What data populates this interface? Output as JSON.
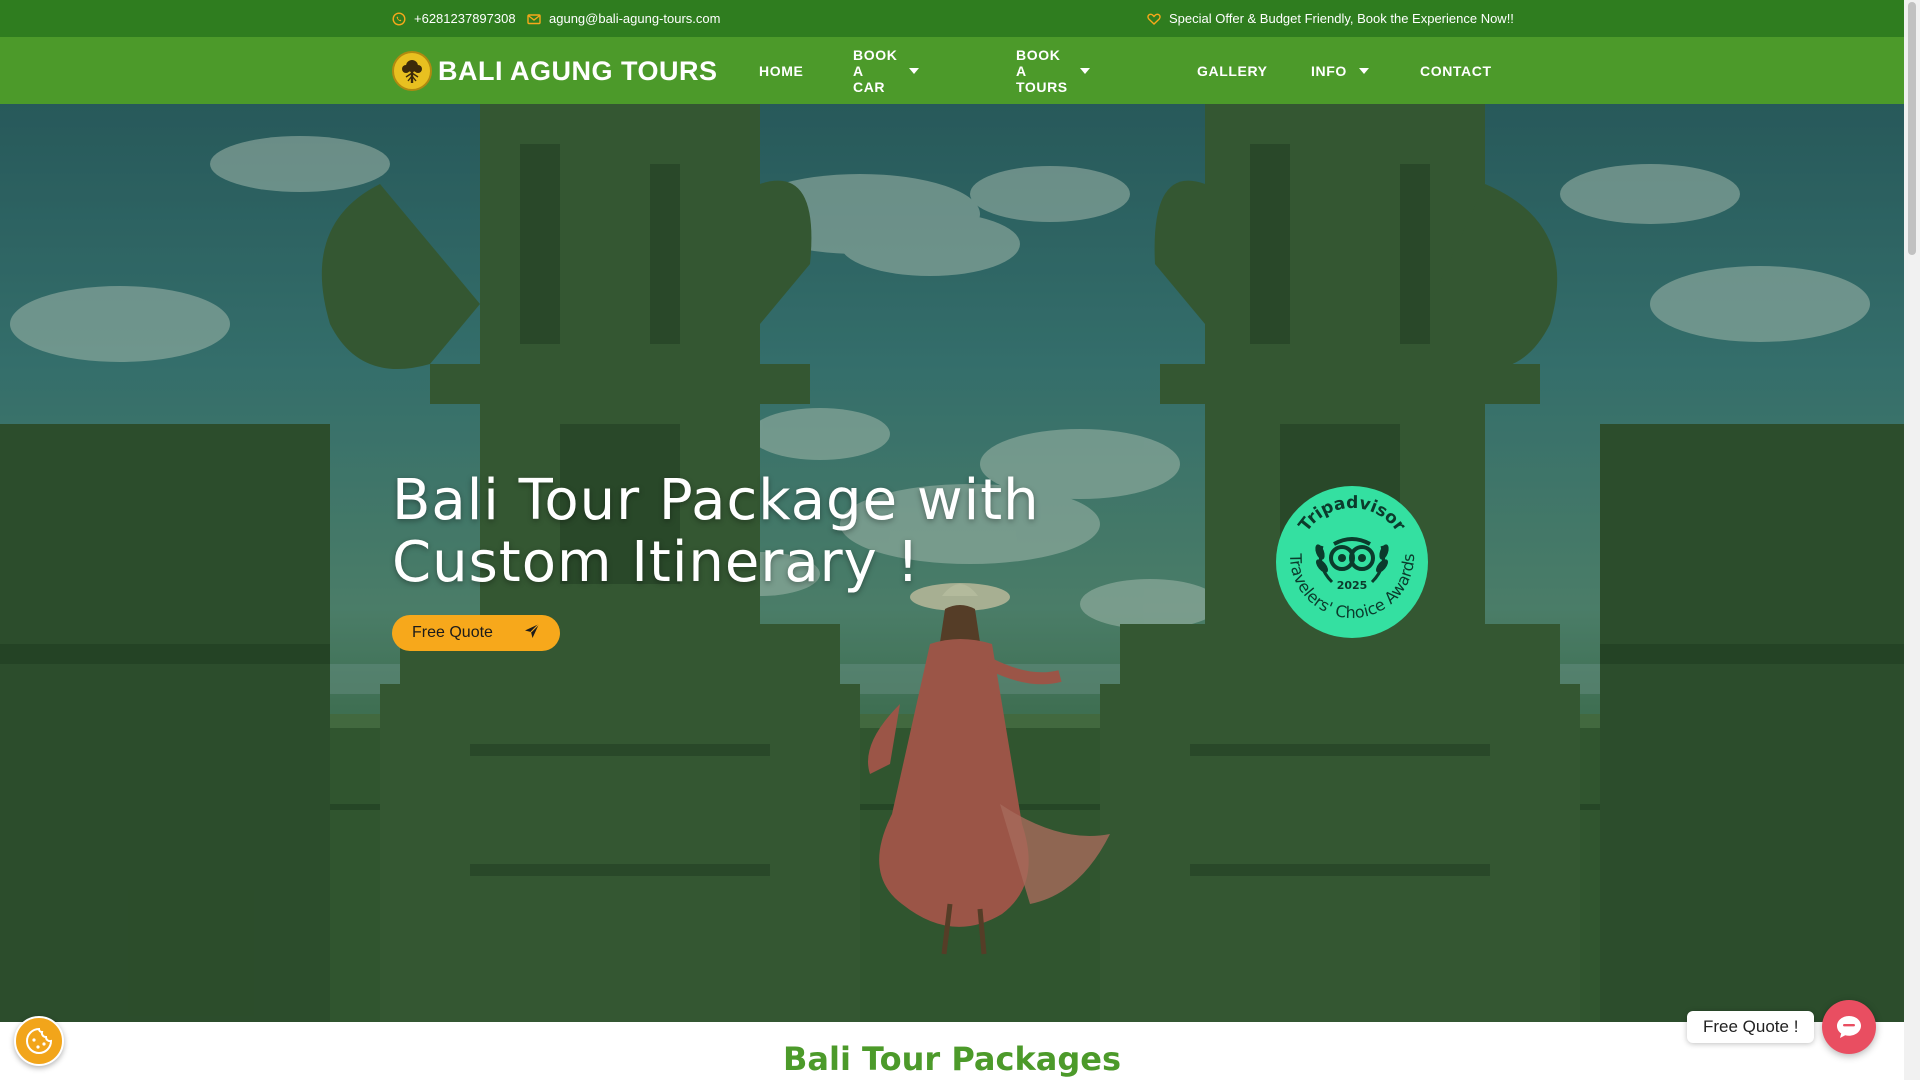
{
  "topbar": {
    "phone": "+6281237897308",
    "email": "agung@bali-agung-tours.com",
    "offer": "Special Offer & Budget Friendly, Book the Experience Now!!",
    "icons": [
      "whatsapp-icon",
      "mail-icon",
      "heart-icon"
    ]
  },
  "brand": {
    "name": "BALI AGUNG TOURS"
  },
  "nav": {
    "home": "HOME",
    "book_car": "BOOK A CAR",
    "book_tours": "BOOK A TOURS",
    "gallery": "GALLERY",
    "info": "INFO",
    "contact": "CONTACT"
  },
  "hero": {
    "title_line1": "Bali Tour Package with",
    "title_line2": "Custom Itinerary !",
    "cta": "Free Quote"
  },
  "badge": {
    "top": "Tripadvisor",
    "year": "2025",
    "ring": "Travelers' Choice Awards"
  },
  "section": {
    "title": "Bali Tour Packages"
  },
  "widgets": {
    "chat_label": "Free Quote !"
  },
  "colors": {
    "topbar": "#2f7d1f",
    "navbar": "#4c9a2a",
    "accent": "#f7a81b",
    "badge": "#34e0a1",
    "chat": "#e94e61"
  }
}
